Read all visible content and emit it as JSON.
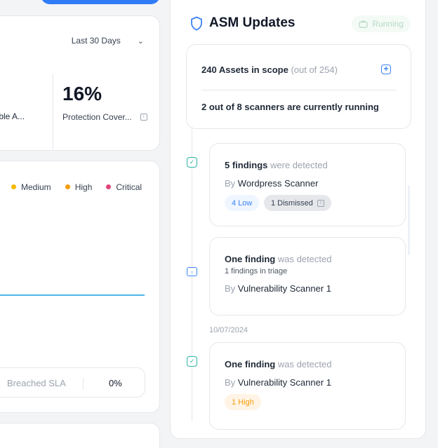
{
  "stats": {
    "range_label": "Last 30 Days",
    "left_label": "erable A...",
    "protection_value": "16%",
    "protection_label": "Protection Cover..."
  },
  "chart_legend": [
    {
      "label": "Medium",
      "color": "#f5b800"
    },
    {
      "label": "High",
      "color": "#f59e0b"
    },
    {
      "label": "Critical",
      "color": "#e0457b"
    }
  ],
  "sla": {
    "label": "Breached SLA",
    "value": "0%"
  },
  "asm": {
    "title": "ASM Updates",
    "status": "Running",
    "scope_count": "240 Assets in scope",
    "scope_total": "(out of 254)",
    "scanners_text": "2 out of 8 scanners are currently running",
    "date_separator": "10/07/2024",
    "findings": [
      {
        "title_bold": "5 findings",
        "title_rest": "were detected",
        "by_prefix": "By",
        "scanner": "Wordpress Scanner",
        "badges": [
          "4 Low",
          "1 Dismissed"
        ]
      },
      {
        "title_bold": "One finding",
        "title_rest": "was detected",
        "subtitle": "1 findings in triage",
        "by_prefix": "By",
        "scanner": "Vulnerability Scanner 1"
      },
      {
        "title_bold": "One finding",
        "title_rest": "was detected",
        "by_prefix": "By",
        "scanner": "Vulnerability Scanner 1",
        "badges": [
          "1 High"
        ]
      }
    ]
  },
  "icons": {
    "shield": "shield-icon",
    "running": "briefcase-icon",
    "plus": "plus-square-icon",
    "check": "check-square-icon",
    "briefcase": "briefcase-icon",
    "info": "info-icon",
    "chevron": "chevron-down-icon"
  }
}
